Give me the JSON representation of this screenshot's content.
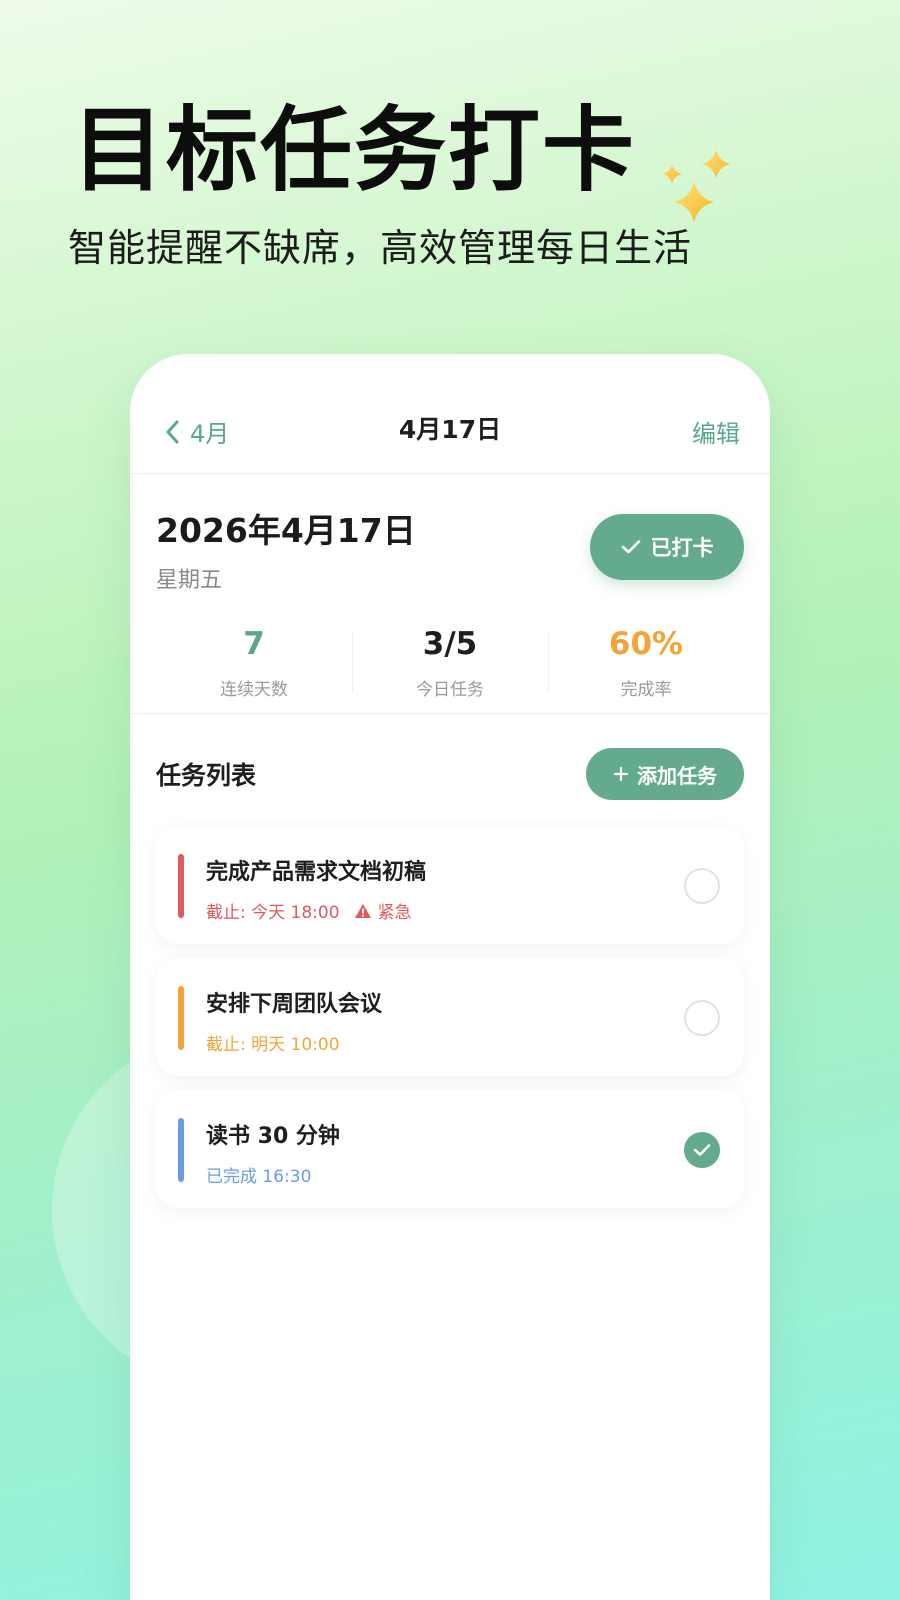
{
  "hero": {
    "title": "目标任务打卡",
    "subtitle": "智能提醒不缺席，高效管理每日生活"
  },
  "nav": {
    "back_label": "4月",
    "title": "4月17日",
    "edit_label": "编辑"
  },
  "date_card": {
    "date": "2026年4月17日",
    "weekday": "星期五",
    "checkin_label": "已打卡"
  },
  "stats": [
    {
      "value": "7",
      "label": "连续天数",
      "color": "#5aa88a"
    },
    {
      "value": "3/5",
      "label": "今日任务",
      "color": "#1e1e1e"
    },
    {
      "value": "60%",
      "label": "完成率",
      "color": "#f2a43a"
    }
  ],
  "tasks_section": {
    "title": "任务列表",
    "add_label": "添加任务"
  },
  "tasks": [
    {
      "title": "完成产品需求文档初稿",
      "meta": "截止: 今天 18:00",
      "tag": "紧急",
      "color": "#e05a5a",
      "done": false
    },
    {
      "title": "安排下周团队会议",
      "meta": "截止: 明天 10:00",
      "tag": "",
      "color": "#f2a43a",
      "done": false
    },
    {
      "title": "读书 30 分钟",
      "meta": "已完成 16:30",
      "tag": "",
      "color": "#6b9be8",
      "done": true
    }
  ],
  "colors": {
    "accent": "#63ab8c",
    "accent_text": "#5aa88a",
    "urgent": "#e05a5a",
    "warning": "#f2a43a",
    "done": "#6b9be8"
  },
  "icons": {
    "sparkles": "sparkles-icon",
    "back": "chevron-left-icon",
    "check": "check-icon",
    "plus": "plus-icon",
    "warning": "warning-triangle-icon"
  }
}
